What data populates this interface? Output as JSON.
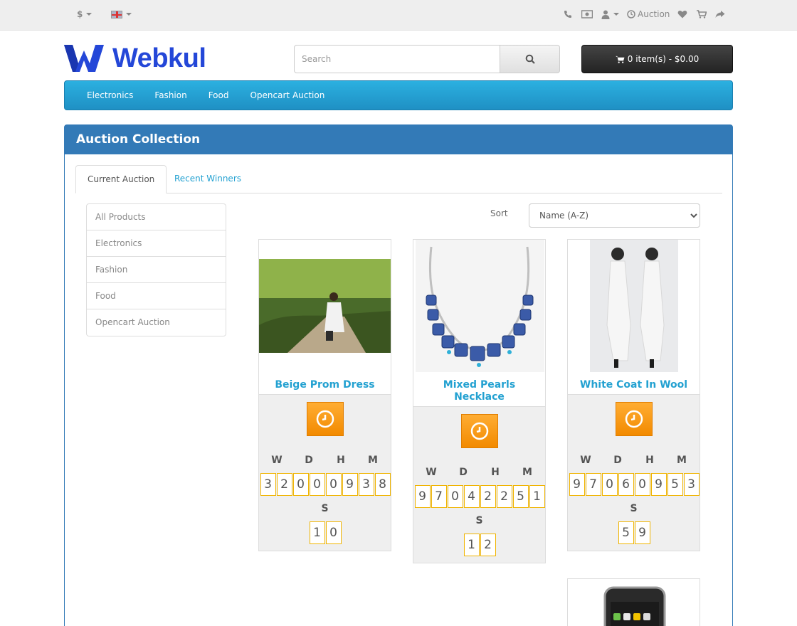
{
  "topbar": {
    "currency": "$",
    "auction_link": "Auction"
  },
  "header": {
    "logo_text": "Webkul",
    "search_placeholder": "Search",
    "cart_label": "0 item(s) - $0.00"
  },
  "menu": {
    "items": [
      "Electronics",
      "Fashion",
      "Food",
      "Opencart Auction"
    ]
  },
  "panel": {
    "title": "Auction Collection",
    "tabs": [
      "Current Auction",
      "Recent Winners"
    ],
    "categories": [
      "All Products",
      "Electronics",
      "Fashion",
      "Food",
      "Opencart Auction"
    ],
    "sort_label": "Sort",
    "sort_value": "Name (A-Z)"
  },
  "timer_units": [
    "W",
    "D",
    "H",
    "M"
  ],
  "seconds_label": "S",
  "products": [
    {
      "name": "Beige Prom Dress",
      "digits": [
        "3",
        "2",
        "0",
        "0",
        "0",
        "9",
        "3",
        "8"
      ],
      "seconds": [
        "1",
        "0"
      ]
    },
    {
      "name": "Mixed Pearls Necklace",
      "digits": [
        "9",
        "7",
        "0",
        "4",
        "2",
        "2",
        "5",
        "1"
      ],
      "seconds": [
        "1",
        "2"
      ]
    },
    {
      "name": "White Coat In Wool",
      "digits": [
        "9",
        "7",
        "0",
        "6",
        "0",
        "9",
        "5",
        "3"
      ],
      "seconds": [
        "5",
        "9"
      ]
    }
  ],
  "colors": {
    "brand_blue": "#2447d8",
    "menu_blue": "#229fd6",
    "panel_blue": "#337ab7",
    "link_blue": "#23a1d1",
    "timer_orange": "#f5960f"
  },
  "icons": [
    "phone-icon",
    "money-icon",
    "user-icon",
    "clock-icon",
    "heart-icon",
    "cart-icon",
    "share-icon",
    "search-icon"
  ]
}
